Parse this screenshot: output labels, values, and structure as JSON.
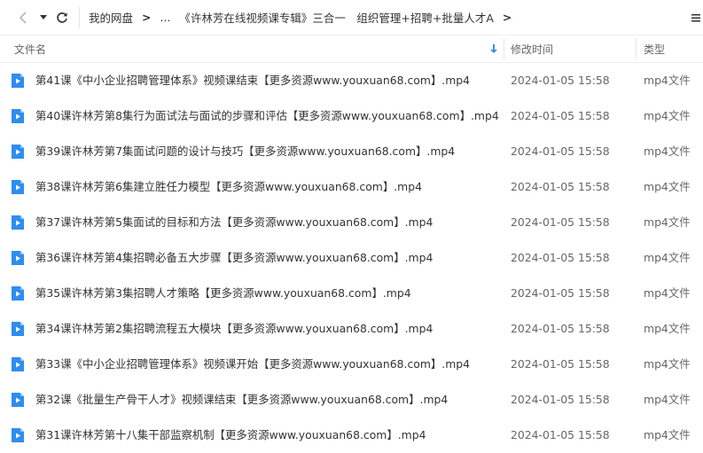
{
  "breadcrumb": {
    "root": "我的网盘",
    "sep": ">",
    "ellipsis": "...",
    "current": "《许林芳在线视频课专辑》三合一　组织管理+招聘+批量人才A",
    "tail": ">"
  },
  "columns": {
    "name": "文件名",
    "modified": "修改时间",
    "type": "类型"
  },
  "icons": {
    "back": "chevron-left-icon",
    "history": "caret-down-icon",
    "refresh": "refresh-icon",
    "menu": "menu-icon",
    "sort": "sort-down-arrow-icon",
    "file": "video-file-icon"
  },
  "colors": {
    "accent": "#3b8fe8",
    "file_icon": "#2f8df0"
  },
  "files": [
    {
      "name": "第41课《中小企业招聘管理体系》视频课结束【更多资源www.youxuan68.com】.mp4",
      "modified": "2024-01-05 15:58",
      "type": "mp4文件"
    },
    {
      "name": "第40课许林芳第8集行为面试法与面试的步骤和评估【更多资源www.youxuan68.com】.mp4",
      "modified": "2024-01-05 15:58",
      "type": "mp4文件"
    },
    {
      "name": "第39课许林芳第7集面试问题的设计与技巧【更多资源www.youxuan68.com】.mp4",
      "modified": "2024-01-05 15:58",
      "type": "mp4文件"
    },
    {
      "name": "第38课许林芳第6集建立胜任力模型【更多资源www.youxuan68.com】.mp4",
      "modified": "2024-01-05 15:58",
      "type": "mp4文件"
    },
    {
      "name": "第37课许林芳第5集面试的目标和方法【更多资源www.youxuan68.com】.mp4",
      "modified": "2024-01-05 15:58",
      "type": "mp4文件"
    },
    {
      "name": "第36课许林芳第4集招聘必备五大步骤【更多资源www.youxuan68.com】.mp4",
      "modified": "2024-01-05 15:58",
      "type": "mp4文件"
    },
    {
      "name": "第35课许林芳第3集招聘人才策略【更多资源www.youxuan68.com】.mp4",
      "modified": "2024-01-05 15:58",
      "type": "mp4文件"
    },
    {
      "name": "第34课许林芳第2集招聘流程五大模块【更多资源www.youxuan68.com】.mp4",
      "modified": "2024-01-05 15:58",
      "type": "mp4文件"
    },
    {
      "name": "第33课《中小企业招聘管理体系》视频课开始【更多资源www.youxuan68.com】.mp4",
      "modified": "2024-01-05 15:58",
      "type": "mp4文件"
    },
    {
      "name": "第32课《批量生产骨干人才》视频课结束【更多资源www.youxuan68.com】.mp4",
      "modified": "2024-01-05 15:58",
      "type": "mp4文件"
    },
    {
      "name": "第31课许林芳第十八集干部监察机制【更多资源www.youxuan68.com】.mp4",
      "modified": "2024-01-05 15:58",
      "type": "mp4文件"
    }
  ]
}
